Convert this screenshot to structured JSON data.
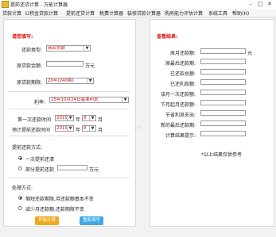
{
  "window": {
    "title": "提前还贷计算 - 万能计算器",
    "min": "–",
    "max": "□",
    "close": "✕"
  },
  "menu": [
    "贷款计算",
    "公积金贷款计算",
    "提前还贷计算",
    "税费计算器",
    "装修贷款计算器",
    "购房能力评估计算",
    "系统工具",
    "帮助(H)"
  ],
  "left": {
    "title": "请您填写:",
    "loan_type_label": "还款类型:",
    "loan_type_value": "商业贷款",
    "total_label": "原贷款金额:",
    "total_value": "",
    "total_unit": "万元",
    "term_label": "原贷款期限:",
    "term_value": "20年(240期)",
    "rate_label": "利率:",
    "rate_value": "15年10月24日基准利率",
    "first_label": "第一次还款时间",
    "first_year": "2019",
    "first_year_unit": "年",
    "first_month": "8",
    "first_month_unit": "月",
    "pre_label": "预计提前还款时间",
    "pre_year": "2019",
    "pre_year_unit": "年",
    "pre_month": "8",
    "pre_month_unit": "月",
    "prepay_title": "提前还款方式:",
    "prepay_all": "一次提前还清",
    "prepay_part": "部分提前还款",
    "prepay_part_unit": "万元",
    "handle_title": "处理方式:",
    "handle_opt1": "缩短还款期限,月还款额基本不变",
    "handle_opt2": "减少月还款额,还款期限不变",
    "btn_calc": "开始计算",
    "btn_reset": "重新填写"
  },
  "right": {
    "title": "查看结果:",
    "rows": [
      {
        "label": "原月还款额:",
        "unit": "元"
      },
      {
        "label": "原最后还款期:",
        "unit": ""
      },
      {
        "label": "已还款总额:",
        "unit": ""
      },
      {
        "label": "已还利息额:",
        "unit": ""
      },
      {
        "label": "该月一次还款额:",
        "unit": ""
      },
      {
        "label": "下月起月还款额:",
        "unit": ""
      },
      {
        "label": "节省利息支出:",
        "unit": ""
      },
      {
        "label": "新的最后还款期:",
        "unit": ""
      },
      {
        "label": "计算结果提示:",
        "unit": ""
      }
    ],
    "note": "*以上结果仅供参考"
  },
  "colors": {
    "accent_red": "#d11111",
    "btn_calc": "#f0a820",
    "btn_reset": "#3fa9e8"
  }
}
